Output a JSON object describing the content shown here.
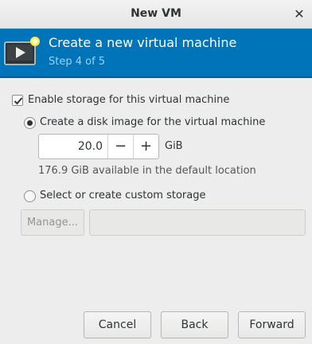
{
  "window": {
    "title": "New VM",
    "close_glyph": "✕"
  },
  "header": {
    "icon": "vm-monitor-icon",
    "title": "Create a new virtual machine",
    "step": "Step 4 of 5",
    "accent_color": "#0074b8"
  },
  "storage": {
    "enable_label": "Enable storage for this virtual machine",
    "enable_checked": true,
    "create_disk_label": "Create a disk image for the virtual machine",
    "create_disk_selected": true,
    "size_value": "20.0",
    "decrement_glyph": "−",
    "increment_glyph": "+",
    "size_unit": "GiB",
    "available_text": "176.9 GiB available in the default location",
    "custom_label": "Select or create custom storage",
    "custom_selected": false,
    "manage_label": "Manage...",
    "custom_path_value": ""
  },
  "footer": {
    "cancel_label": "Cancel",
    "back_label": "Back",
    "forward_label": "Forward"
  }
}
